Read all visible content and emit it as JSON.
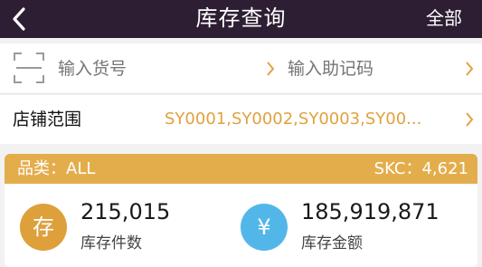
{
  "header": {
    "title": "库存查询",
    "right_label": "全部"
  },
  "search": {
    "item_no_placeholder": "输入货号",
    "mnemonic_placeholder": "输入助记码"
  },
  "store": {
    "label": "店铺范围",
    "value": "SY0001,SY0002,SY0003,SY00..."
  },
  "summary": {
    "category_text": "品类：ALL",
    "skc_text": "SKC：4,621",
    "stock_qty": {
      "icon_char": "存",
      "value": "215,015",
      "label": "库存件数",
      "color": "#dda03b"
    },
    "stock_amount": {
      "icon_char": "¥",
      "value": "185,919,871",
      "label": "库存金额",
      "color": "#52b7e8"
    }
  },
  "colors": {
    "header_bg": "#2e1e33",
    "accent": "#e0a23e",
    "summary_bar": "#e4ad4c"
  }
}
